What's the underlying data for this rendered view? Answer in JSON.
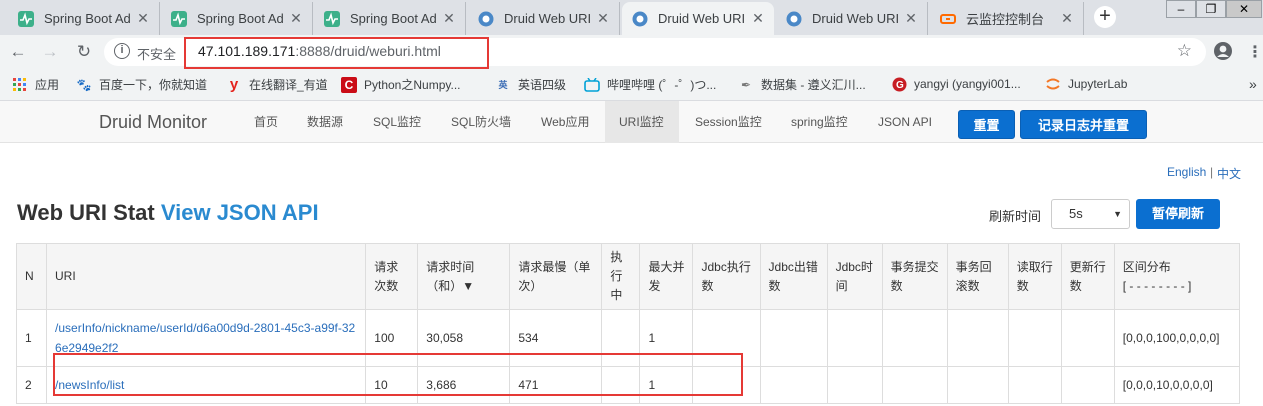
{
  "browser": {
    "tabs": [
      {
        "label": "Spring Boot Ad",
        "icon": "spring-boot-admin-icon"
      },
      {
        "label": "Spring Boot Ad",
        "icon": "spring-boot-admin-icon"
      },
      {
        "label": "Spring Boot Ad",
        "icon": "spring-boot-admin-icon"
      },
      {
        "label": "Druid Web URI",
        "icon": "druid-icon"
      },
      {
        "label": "Druid Web URI",
        "icon": "druid-icon",
        "active": true
      },
      {
        "label": "Druid Web URI",
        "icon": "druid-icon"
      },
      {
        "label": "云监控控制台",
        "icon": "aliyun-icon"
      }
    ],
    "security_label": "不安全",
    "url_host": "47.101.189.171",
    "url_path": ":8888/druid/weburi.html",
    "bookmarks": [
      {
        "label": "应用",
        "icon": "apps-grid-icon"
      },
      {
        "label": "百度一下，你就知道",
        "icon": "baidu-paw-icon"
      },
      {
        "label": "在线翻译_有道",
        "icon": "youdao-icon"
      },
      {
        "label": "Python之Numpy...",
        "icon": "csdn-icon"
      },
      {
        "label": "英语四级",
        "icon": "english-icon"
      },
      {
        "label": "哔哩哔哩 (゜-゜)つ...",
        "icon": "bilibili-icon"
      },
      {
        "label": "数据集 - 遵义汇川...",
        "icon": "feather-icon"
      },
      {
        "label": "yangyi (yangyi001...",
        "icon": "gitee-icon"
      },
      {
        "label": "JupyterLab",
        "icon": "jupyter-icon"
      }
    ],
    "bookmarks_more": "»"
  },
  "druid": {
    "brand": "Druid Monitor",
    "nav": [
      "首页",
      "数据源",
      "SQL监控",
      "SQL防火墙",
      "Web应用",
      "URI监控",
      "Session监控",
      "spring监控",
      "JSON API"
    ],
    "active_nav": "URI监控",
    "reset_button": "重置",
    "reset_log_button": "记录日志并重置",
    "lang_en": "English",
    "lang_sep": "|",
    "lang_zh": "中文",
    "title": "Web URI Stat",
    "title_link": "View JSON API",
    "refresh_label": "刷新时间",
    "refresh_value": "5s",
    "pause_button": "暂停刷新",
    "table": {
      "headers": [
        "N",
        "URI",
        "请求次数",
        "请求时间（和）▼",
        "请求最慢（单次）",
        "执行中",
        "最大并发",
        "Jdbc执行数",
        "Jdbc出错数",
        "Jdbc时间",
        "事务提交数",
        "事务回滚数",
        "读取行数",
        "更新行数",
        "区间分布\n[ - - - - - - - - ]"
      ],
      "rows": [
        {
          "n": "1",
          "uri": "/userInfo/nickname/userId/d6a00d9d-2801-45c3-a99f-326e2949e2f2",
          "count": "100",
          "time_sum": "30,058",
          "slowest": "534",
          "running": "",
          "max_concurrent": "1",
          "jdbc_exec": "",
          "jdbc_err": "",
          "jdbc_time": "",
          "tx_commit": "",
          "tx_rollback": "",
          "read_rows": "",
          "update_rows": "",
          "histogram": "[0,0,0,100,0,0,0,0]"
        },
        {
          "n": "2",
          "uri": "/newsInfo/list",
          "count": "10",
          "time_sum": "3,686",
          "slowest": "471",
          "running": "",
          "max_concurrent": "1",
          "jdbc_exec": "",
          "jdbc_err": "",
          "jdbc_time": "",
          "tx_commit": "",
          "tx_rollback": "",
          "read_rows": "",
          "update_rows": "",
          "histogram": "[0,0,0,10,0,0,0,0]"
        }
      ]
    }
  },
  "colors": {
    "highlight": "#e53935",
    "link": "#2a6ebb",
    "button": "#0b6fd0"
  }
}
